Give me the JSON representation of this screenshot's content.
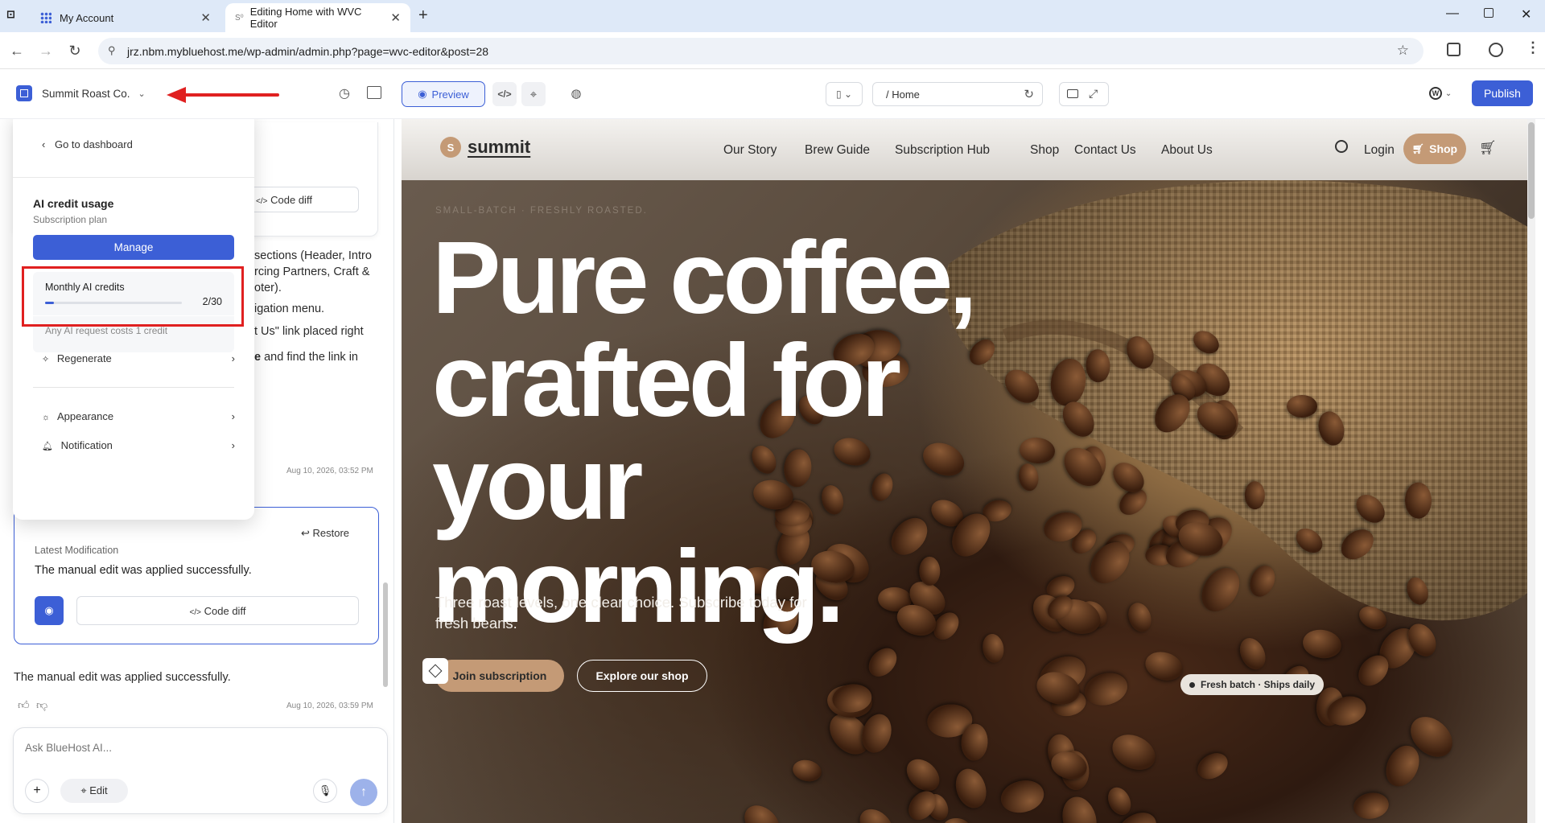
{
  "browser": {
    "tabs": [
      {
        "title": "My Account",
        "active": false
      },
      {
        "title": "Editing Home with WVC Editor",
        "active": true
      }
    ],
    "url": "jrz.nbm.mybluehost.me/wp-admin/admin.php?page=wvc-editor&post=28"
  },
  "editor": {
    "site_name": "Summit Roast Co.",
    "preview_label": "Preview",
    "page_path": "/ Home",
    "publish_label": "Publish"
  },
  "menu": {
    "back_label": "Go to dashboard",
    "credit_title": "AI credit usage",
    "credit_subtitle": "Subscription plan",
    "manage_label": "Manage",
    "monthly_label": "Monthly AI credits",
    "credits_used": 2,
    "credits_total": 30,
    "credits_text": "2/30",
    "cost_note": "Any AI request costs 1 credit",
    "items": [
      {
        "label": "Regenerate",
        "icon": "sparkle-icon"
      },
      {
        "label": "Appearance",
        "icon": "sun-icon"
      },
      {
        "label": "Notification",
        "icon": "bell-icon"
      }
    ]
  },
  "chat": {
    "code_diff_label": "Code diff",
    "partial_lines": [
      "sections (Header, Intro",
      "rcing Partners, Craft &",
      "oter).",
      "igation menu.",
      "t Us\" link placed right",
      "and find the link in"
    ],
    "partial_bold": "e",
    "timestamp1": "Aug 10, 2026, 03:52 PM",
    "restore_label": "Restore",
    "latest_label": "Latest Modification",
    "latest_text": "The manual edit was applied successfully.",
    "message_text": "The manual edit was applied successfully.",
    "timestamp2": "Aug 10, 2026, 03:59 PM",
    "input_placeholder": "Ask BlueHost AI...",
    "edit_label": "Edit"
  },
  "site": {
    "logo_letter": "S",
    "logo_text": "summit",
    "nav": [
      "Our Story",
      "Brew Guide",
      "Subscription Hub",
      "Shop",
      "Contact Us",
      "About Us"
    ],
    "login": "Login",
    "shop_button": "Shop",
    "eyebrow": "SMALL-BATCH · FRESHLY ROASTED.",
    "headline_lines": [
      "Pure coffee,",
      "crafted for",
      "your",
      "morning."
    ],
    "subtext_lines": [
      "Three roast levels, one clear choice. Subscribe today for",
      "fresh beans."
    ],
    "cta_primary": "Join subscription",
    "cta_secondary": "Explore our shop",
    "badge": "Fresh batch · Ships daily"
  },
  "colors": {
    "accent": "#3c5fd6",
    "highlight": "#e02020",
    "shop_pill": "#c49a76"
  }
}
